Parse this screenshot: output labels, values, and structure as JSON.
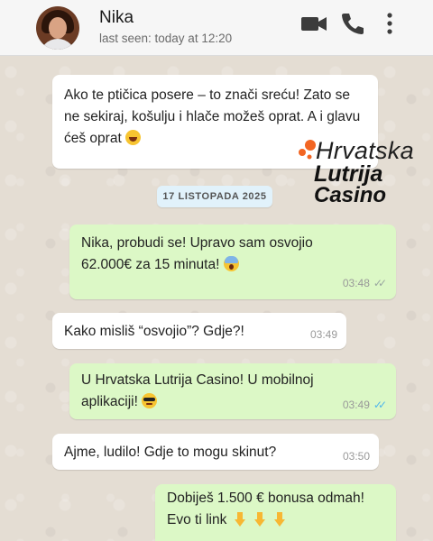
{
  "header": {
    "contact_name": "Nika",
    "last_seen": "last seen: today at 12:20",
    "icons": [
      "video-call-icon",
      "phone-icon",
      "more-options-icon"
    ]
  },
  "logo": {
    "line1": "Hrvatska",
    "line2": "Lutrija",
    "line3": "Casino"
  },
  "date_chip": "17 LISTOPADA 2025",
  "messages": [
    {
      "direction": "incoming",
      "text": "Ako te ptičica posere – to znači sreću! Zato se ne sekiraj, košulju i hlače možeš oprat. A i glavu ćeš oprat",
      "emoji": "laughing-emoji",
      "time": ""
    },
    {
      "direction": "outgoing",
      "text": "Nika, probudi se! Upravo sam osvojio 62.000€ za 15 minuta!",
      "emoji": "screaming-emoji",
      "time": "03:48",
      "status": "delivered"
    },
    {
      "direction": "incoming",
      "text": "Kako misliš “osvojio”? Gdje?!",
      "time": "03:49"
    },
    {
      "direction": "outgoing",
      "text": "U Hrvatska Lutrija Casino! U mobilnoj aplikaciji!",
      "emoji": "sunglasses-emoji",
      "time": "03:49",
      "status": "read"
    },
    {
      "direction": "incoming",
      "text": "Ajme, ludilo! Gdje to mogu skinut?",
      "time": "03:50"
    },
    {
      "direction": "outgoing",
      "text_line1": "Dobiješ 1.500 € bonusa odmah!",
      "text_line2": "Evo ti link",
      "emoji": "pointing-down-emoji",
      "time": ""
    }
  ],
  "colors": {
    "incoming_bubble": "#ffffff",
    "outgoing_bubble": "#dcf8c6",
    "read_ticks": "#4fb6ec",
    "logo_dots": "#f26522"
  }
}
